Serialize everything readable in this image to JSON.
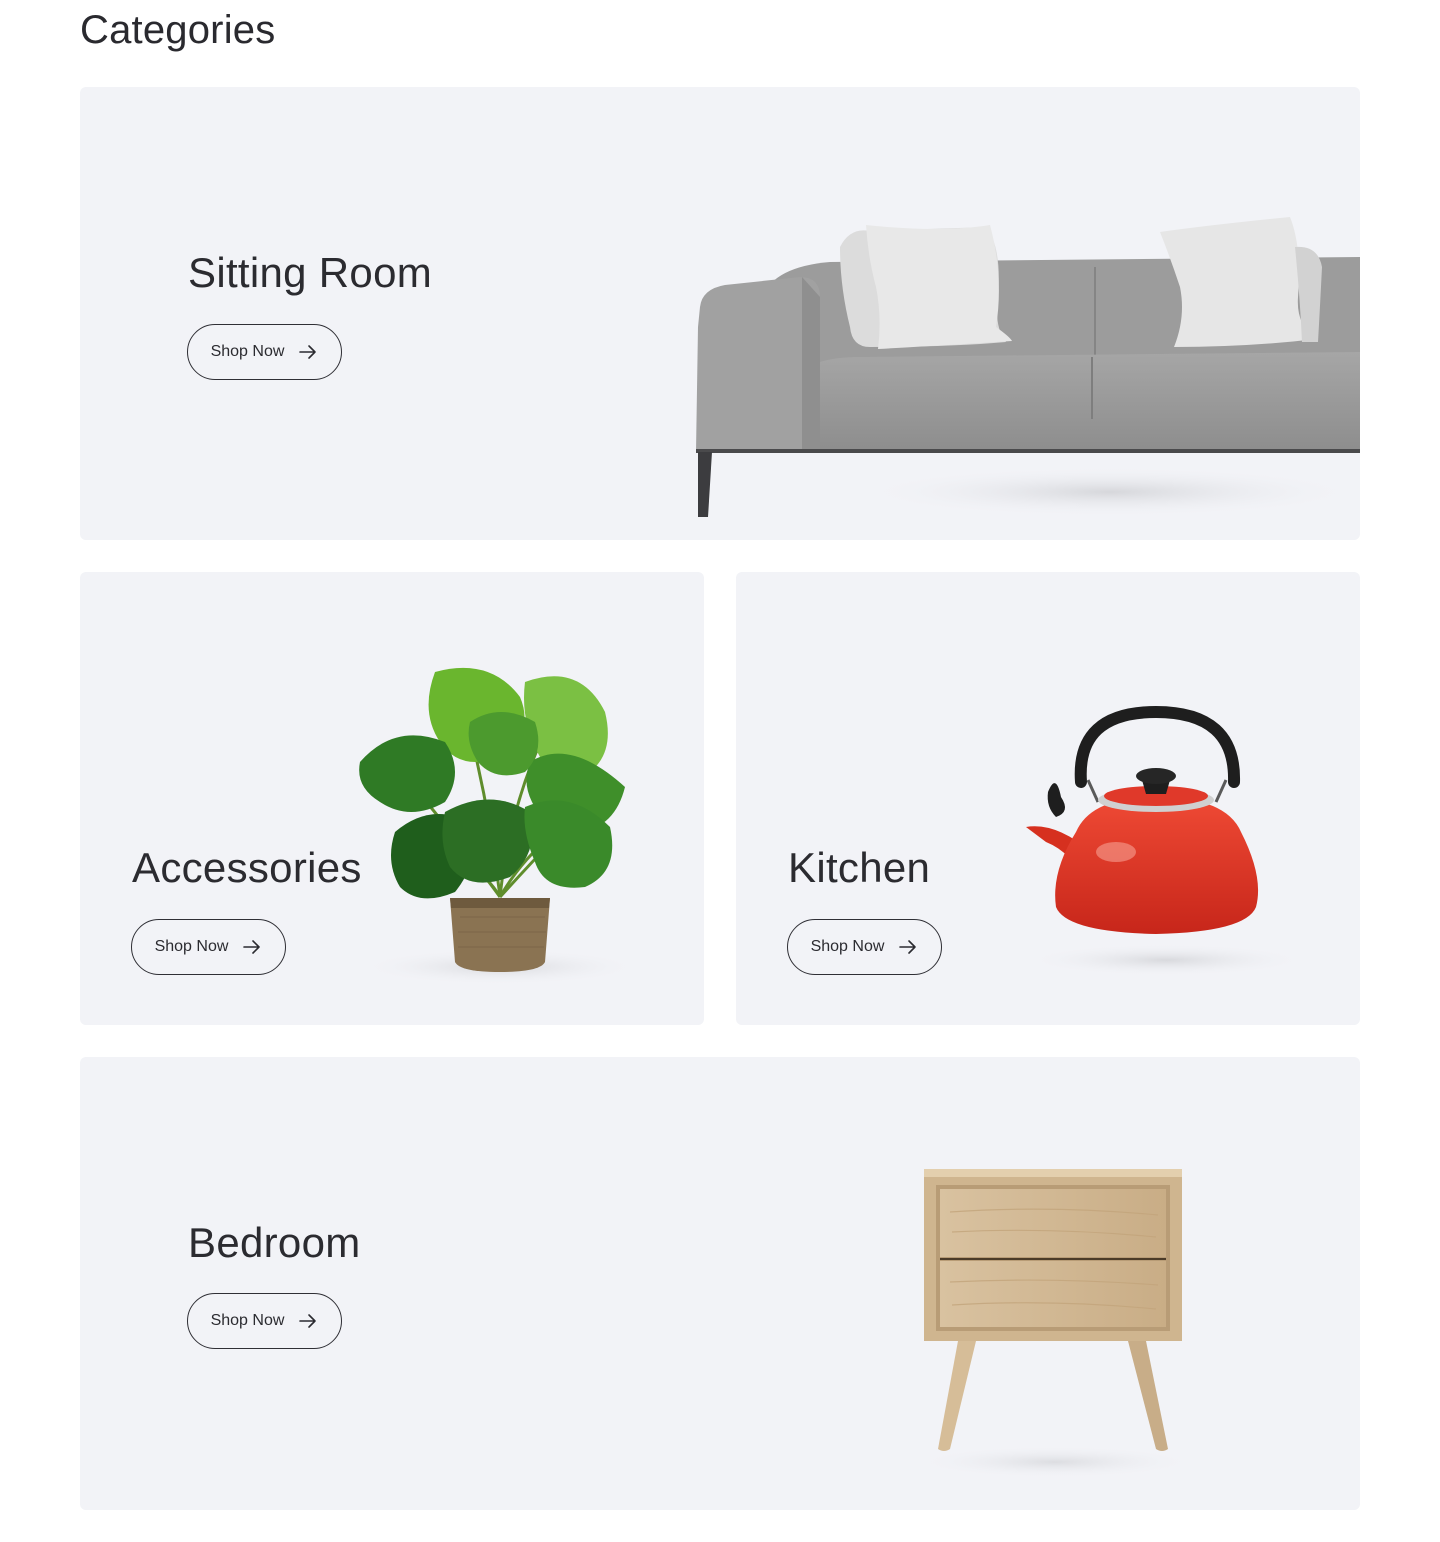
{
  "section": {
    "title": "Categories"
  },
  "cards": {
    "sitting_room": {
      "title": "Sitting Room",
      "button": "Shop Now"
    },
    "accessories": {
      "title": "Accessories",
      "button": "Shop Now"
    },
    "kitchen": {
      "title": "Kitchen",
      "button": "Shop Now"
    },
    "bedroom": {
      "title": "Bedroom",
      "button": "Shop Now"
    }
  },
  "icons": {
    "button_icon": "arrow-right-icon"
  },
  "colors": {
    "card_background": "#f2f3f7",
    "text": "#2b2b30",
    "button_border": "#2f2f35"
  }
}
